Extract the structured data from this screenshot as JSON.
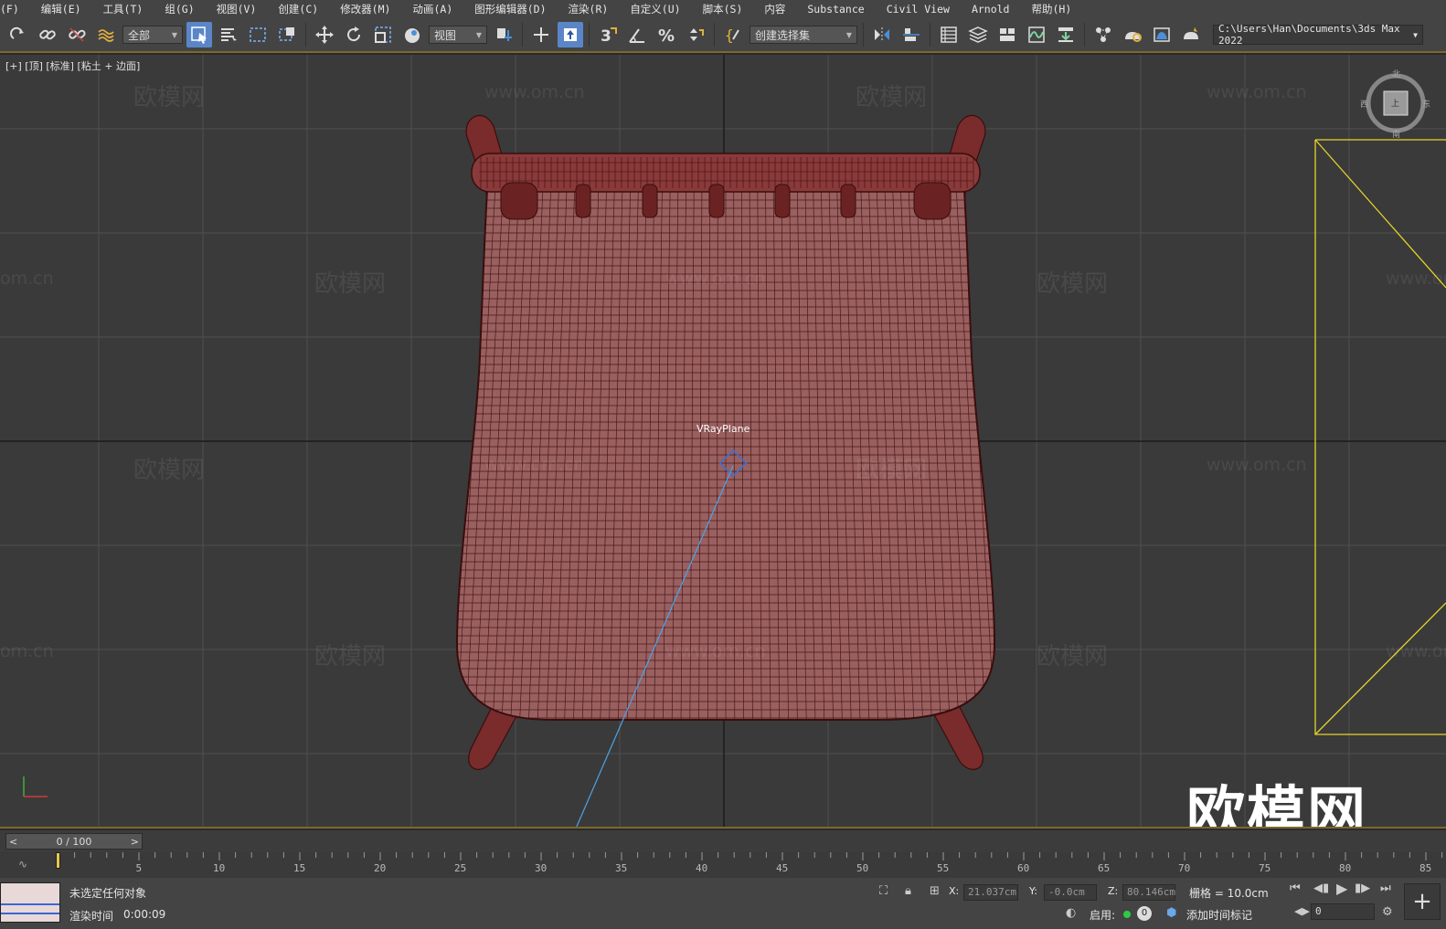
{
  "menu": [
    "(F)",
    "编辑(E)",
    "工具(T)",
    "组(G)",
    "视图(V)",
    "创建(C)",
    "修改器(M)",
    "动画(A)",
    "图形编辑器(D)",
    "渲染(R)",
    "自定义(U)",
    "脚本(S)",
    "内容",
    "Substance",
    "Civil View",
    "Arnold",
    "帮助(H)"
  ],
  "toolbar": {
    "selection_filter": "全部",
    "ref_coord": "视图",
    "named_selection": "创建选择集",
    "project_path": "C:\\Users\\Han\\Documents\\3ds Max 2022"
  },
  "viewport": {
    "label": "[+] [顶] [标准] [粘土 + 边面]",
    "object_label": "VRayPlane",
    "watermark_text": "欧模网",
    "watermark_url": "www.om.cn",
    "watermark_url_cut": "om.cn",
    "big_watermark": "欧模网",
    "compass": {
      "north": "北",
      "south": "南",
      "east": "东",
      "west": "西",
      "face": "上"
    },
    "colors": {
      "model_fill": "#9a6060",
      "wire": "#3a0d0d",
      "grid": "#505050",
      "axis": "#141414",
      "frame": "#e6d42a",
      "camera_line": "#4da3e6"
    }
  },
  "timeline": {
    "frame_display": "0 / 100",
    "prev": "<",
    "next": ">",
    "ticks": [
      "5",
      "10",
      "15",
      "20",
      "25",
      "30",
      "35",
      "40",
      "45",
      "50",
      "55",
      "60",
      "65",
      "70",
      "75",
      "80",
      "85"
    ]
  },
  "status": {
    "selection": "未选定任何对象",
    "render_time_label": "渲染时间",
    "render_time_value": "0:00:09",
    "x_label": "X:",
    "x_value": "21.037cm",
    "y_label": "Y:",
    "y_value": "-0.0cm",
    "z_label": "Z:",
    "z_value": "80.146cm",
    "grid": "栅格 = 10.0cm",
    "enable": "启用:",
    "enable_count": "0",
    "add_marker": "添加时间标记",
    "frame_field": "0"
  }
}
